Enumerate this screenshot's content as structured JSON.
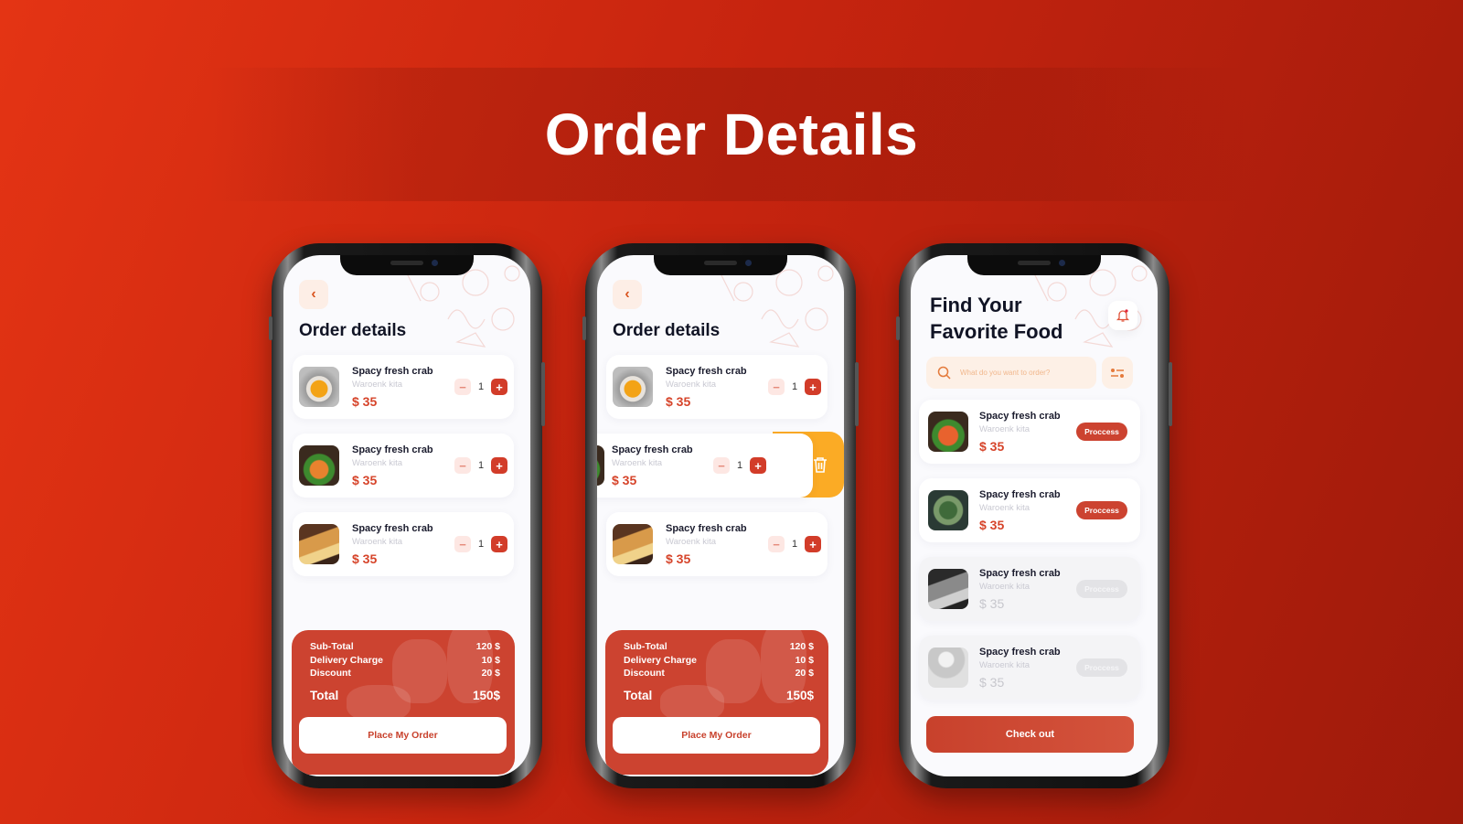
{
  "banner": {
    "title": "Order Details"
  },
  "colors": {
    "accent": "#d23c29",
    "summary_bg": "#cc4330",
    "delete_bg": "#fbab25",
    "search_bg": "#fdf0e6"
  },
  "phone1": {
    "title": "Order details",
    "items": [
      {
        "name": "Spacy fresh crab",
        "shop": "Waroenk kita",
        "price": "$ 35",
        "qty": "1",
        "image": "soup-bowl"
      },
      {
        "name": "Spacy fresh crab",
        "shop": "Waroenk kita",
        "price": "$ 35",
        "qty": "1",
        "image": "pasta-plate"
      },
      {
        "name": "Spacy fresh crab",
        "shop": "Waroenk kita",
        "price": "$ 35",
        "qty": "1",
        "image": "sandwich"
      }
    ],
    "summary": {
      "subtotal_label": "Sub-Total",
      "subtotal": "120 $",
      "delivery_label": "Delivery Charge",
      "delivery": "10 $",
      "discount_label": "Discount",
      "discount": "20 $",
      "total_label": "Total",
      "total": "150$"
    },
    "button": "Place My Order"
  },
  "phone2": {
    "title": "Order details",
    "items": [
      {
        "name": "Spacy fresh crab",
        "shop": "Waroenk kita",
        "price": "$ 35",
        "qty": "1"
      },
      {
        "name": "Spacy fresh crab",
        "shop": "Waroenk kita",
        "price": "$ 35",
        "qty": "1"
      },
      {
        "name": "Spacy fresh crab",
        "shop": "Waroenk kita",
        "price": "$ 35",
        "qty": "1"
      }
    ],
    "summary": {
      "subtotal_label": "Sub-Total",
      "subtotal": "120 $",
      "delivery_label": "Delivery Charge",
      "delivery": "10 $",
      "discount_label": "Discount",
      "discount": "20 $",
      "total_label": "Total",
      "total": "150$"
    },
    "button": "Place My Order",
    "delete_icon": "trash-icon"
  },
  "phone3": {
    "title_line1": "Find Your",
    "title_line2": "Favorite Food",
    "search_placeholder": "What do you want to order?",
    "items": [
      {
        "name": "Spacy fresh crab",
        "shop": "Waroenk kita",
        "price": "$ 35",
        "status": "Proccess",
        "active": true
      },
      {
        "name": "Spacy fresh crab",
        "shop": "Waroenk kita",
        "price": "$ 35",
        "status": "Proccess",
        "active": true
      },
      {
        "name": "Spacy fresh crab",
        "shop": "Waroenk kita",
        "price": "$ 35",
        "status": "Proccess",
        "active": false
      },
      {
        "name": "Spacy fresh crab",
        "shop": "Waroenk kita",
        "price": "$ 35",
        "status": "Proccess",
        "active": false
      }
    ],
    "button": "Check out"
  }
}
